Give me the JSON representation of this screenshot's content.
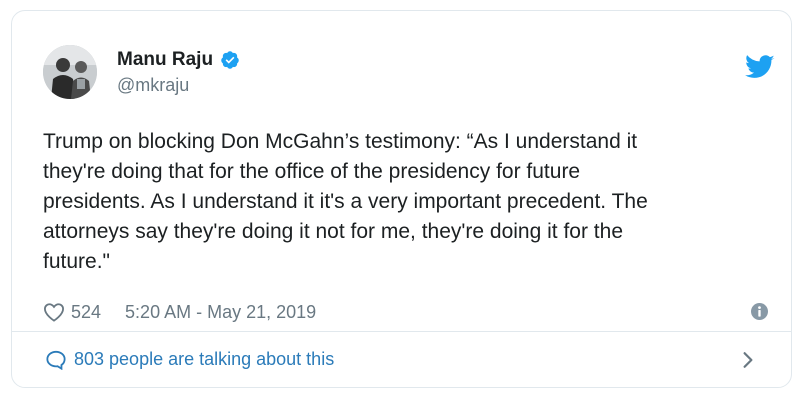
{
  "author": {
    "name": "Manu Raju",
    "handle": "@mkraju",
    "verified_icon": "verified-badge-icon",
    "avatar": "author-photo"
  },
  "brand": {
    "icon": "twitter-bird-icon",
    "color": "#1da1f2"
  },
  "tweet": {
    "text": "Trump on blocking Don McGahn’s testimony: “As I understand it\nthey're doing that for the office of the presidency for future\npresidents. As I understand it it's a very important precedent. The\nattorneys say they're doing it not for me, they're doing it for the\nfuture.\""
  },
  "meta": {
    "likes": "524",
    "like_icon": "heart-icon",
    "timestamp": "5:20 AM - May 21, 2019",
    "info_icon": "info-icon"
  },
  "conversation": {
    "label": "803 people are talking about this",
    "icon": "speech-bubble-icon",
    "chevron_icon": "chevron-right-icon",
    "link_color": "#2b7bb9"
  },
  "colors": {
    "text": "#1c2022",
    "muted": "#697882",
    "border": "#e1e8ed"
  }
}
